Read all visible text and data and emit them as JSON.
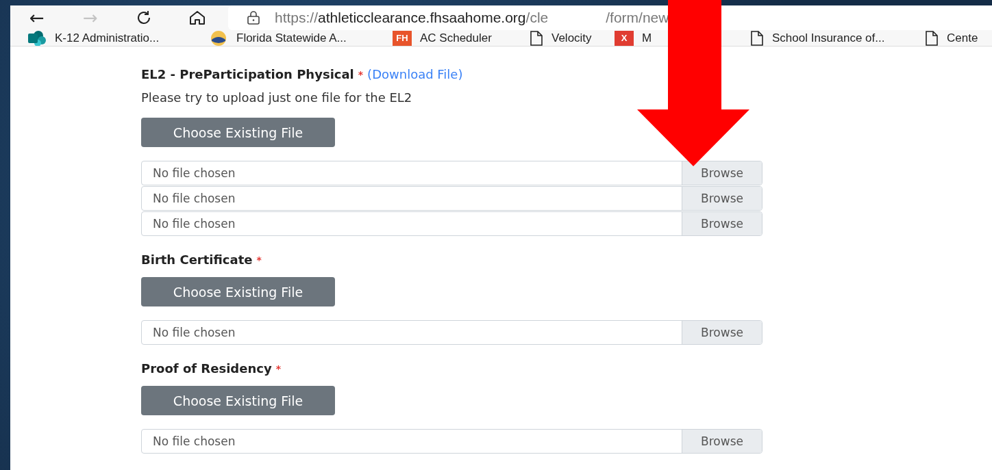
{
  "browser": {
    "back": "←",
    "forward": "→",
    "url": {
      "scheme": "https://",
      "host": "athleticclearance.fhsaahome.org",
      "path_start": "/cle",
      "path_end": "/form/new"
    }
  },
  "bookmarks": [
    {
      "kind": "sharepoint",
      "label": "K-12 Administratio..."
    },
    {
      "kind": "seal",
      "label": "Florida Statewide A..."
    },
    {
      "kind": "fh",
      "badge": "FH",
      "label": "AC Scheduler"
    },
    {
      "kind": "page",
      "label": "Velocity"
    },
    {
      "kind": "x",
      "badge": "X",
      "label": "M"
    },
    {
      "kind": "page",
      "label": "School Insurance of..."
    },
    {
      "kind": "page",
      "label": "Cente"
    }
  ],
  "sections": [
    {
      "title": "EL2 - PreParticipation Physical",
      "required": "*",
      "link": "(Download File)",
      "note": "Please try to upload just one file for the EL2",
      "choose_button": "Choose Existing File",
      "files": [
        {
          "text": "No file chosen",
          "button": "Browse"
        },
        {
          "text": "No file chosen",
          "button": "Browse"
        },
        {
          "text": "No file chosen",
          "button": "Browse"
        }
      ]
    },
    {
      "title": "Birth Certificate",
      "required": "*",
      "choose_button": "Choose Existing File",
      "files": [
        {
          "text": "No file chosen",
          "button": "Browse"
        }
      ]
    },
    {
      "title": "Proof of Residency",
      "required": "*",
      "choose_button": "Choose Existing File",
      "files": [
        {
          "text": "No file chosen",
          "button": "Browse"
        }
      ]
    }
  ]
}
